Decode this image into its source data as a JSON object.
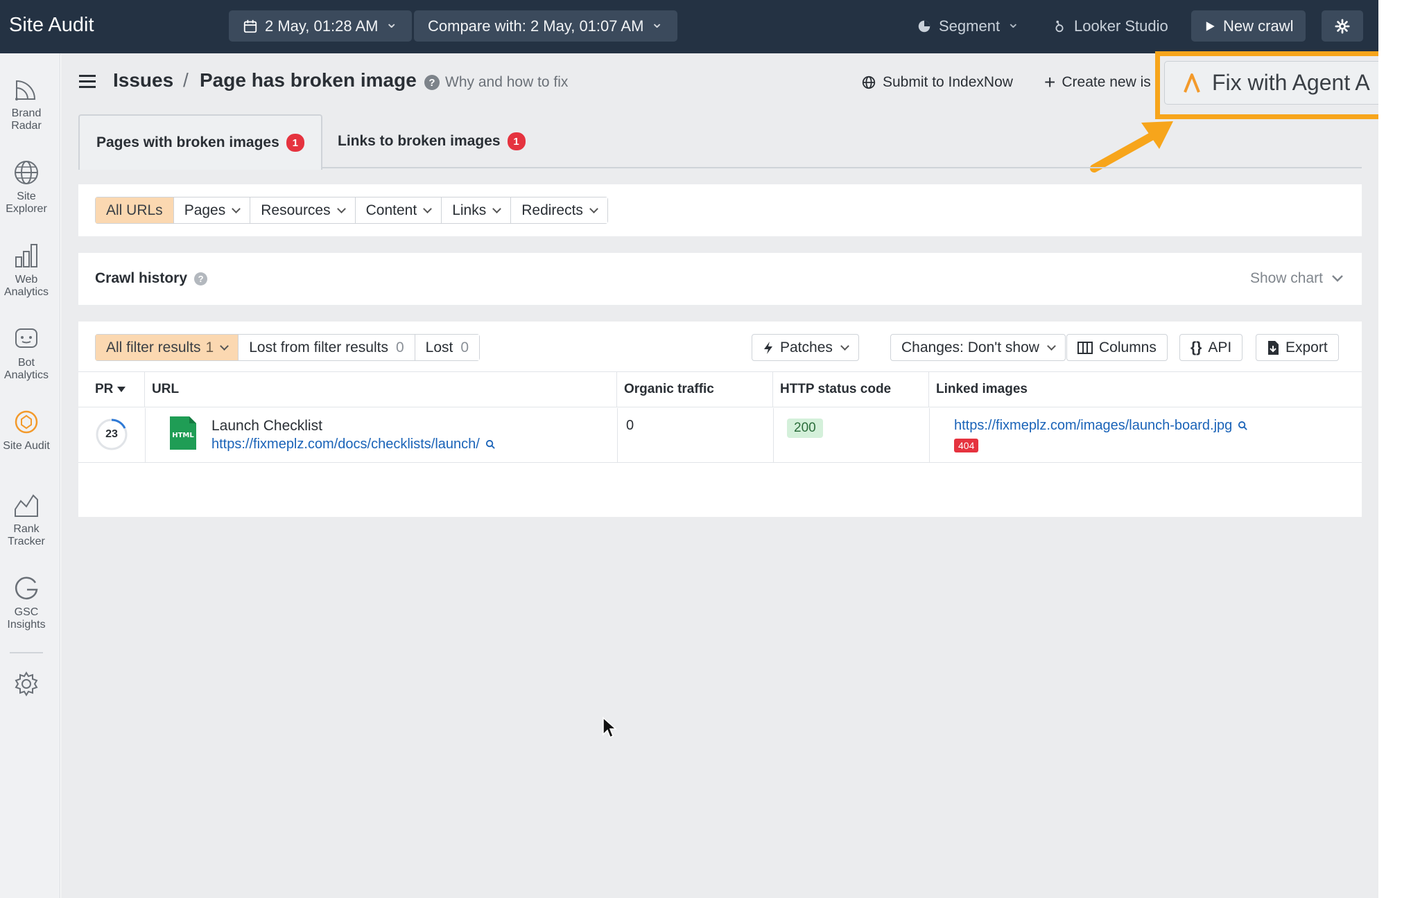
{
  "topbar": {
    "title": "Site Audit",
    "date_label": "2 May, 01:28 AM",
    "compare_label": "Compare with: 2 May, 01:07 AM",
    "segment_label": "Segment",
    "looker_label": "Looker Studio",
    "new_crawl_label": "New crawl"
  },
  "rail": {
    "items": [
      {
        "label": "Brand Radar",
        "icon": "brand-radar-icon"
      },
      {
        "label": "Site Explorer",
        "icon": "globe-icon"
      },
      {
        "label": "Web Analytics",
        "icon": "bar-chart-icon"
      },
      {
        "label": "Bot Analytics",
        "icon": "bot-icon"
      },
      {
        "label": "Site Audit",
        "icon": "site-audit-icon"
      },
      {
        "label": "Rank Tracker",
        "icon": "rank-tracker-icon"
      },
      {
        "label": "GSC Insights",
        "icon": "google-icon"
      }
    ]
  },
  "header": {
    "crumb_root": "Issues",
    "crumb_sep": "/",
    "crumb_current": "Page has broken image",
    "why_label": "Why and how to fix",
    "submit_label": "Submit to IndexNow",
    "create_label": "Create new is",
    "fix_label": "Fix with Agent A",
    "accent_color": "#f7a51b"
  },
  "tabs": [
    {
      "label": "Pages with broken images",
      "count": "1"
    },
    {
      "label": "Links to broken images",
      "count": "1"
    }
  ],
  "url_filters": [
    "All URLs",
    "Pages",
    "Resources",
    "Content",
    "Links",
    "Redirects"
  ],
  "crawl_history": {
    "title": "Crawl history",
    "show_chart": "Show chart"
  },
  "results": {
    "filters": [
      {
        "label": "All filter results",
        "count": "1"
      },
      {
        "label": "Lost from filter results",
        "count": "0"
      },
      {
        "label": "Lost",
        "count": "0"
      }
    ],
    "patches_label": "Patches",
    "changes_label": "Changes: Don't show",
    "columns_label": "Columns",
    "api_label": "API",
    "export_label": "Export"
  },
  "table": {
    "headers": [
      "PR",
      "URL",
      "Organic traffic",
      "HTTP status code",
      "Linked images"
    ],
    "rows": [
      {
        "pr": "23",
        "file_type": "HTML",
        "title": "Launch Checklist",
        "url": "https://fixmeplz.com/docs/checklists/launch/",
        "organic_traffic": "0",
        "http_status": "200",
        "linked_image": "https://fixmeplz.com/images/launch-board.jpg",
        "linked_status": "404"
      }
    ]
  }
}
